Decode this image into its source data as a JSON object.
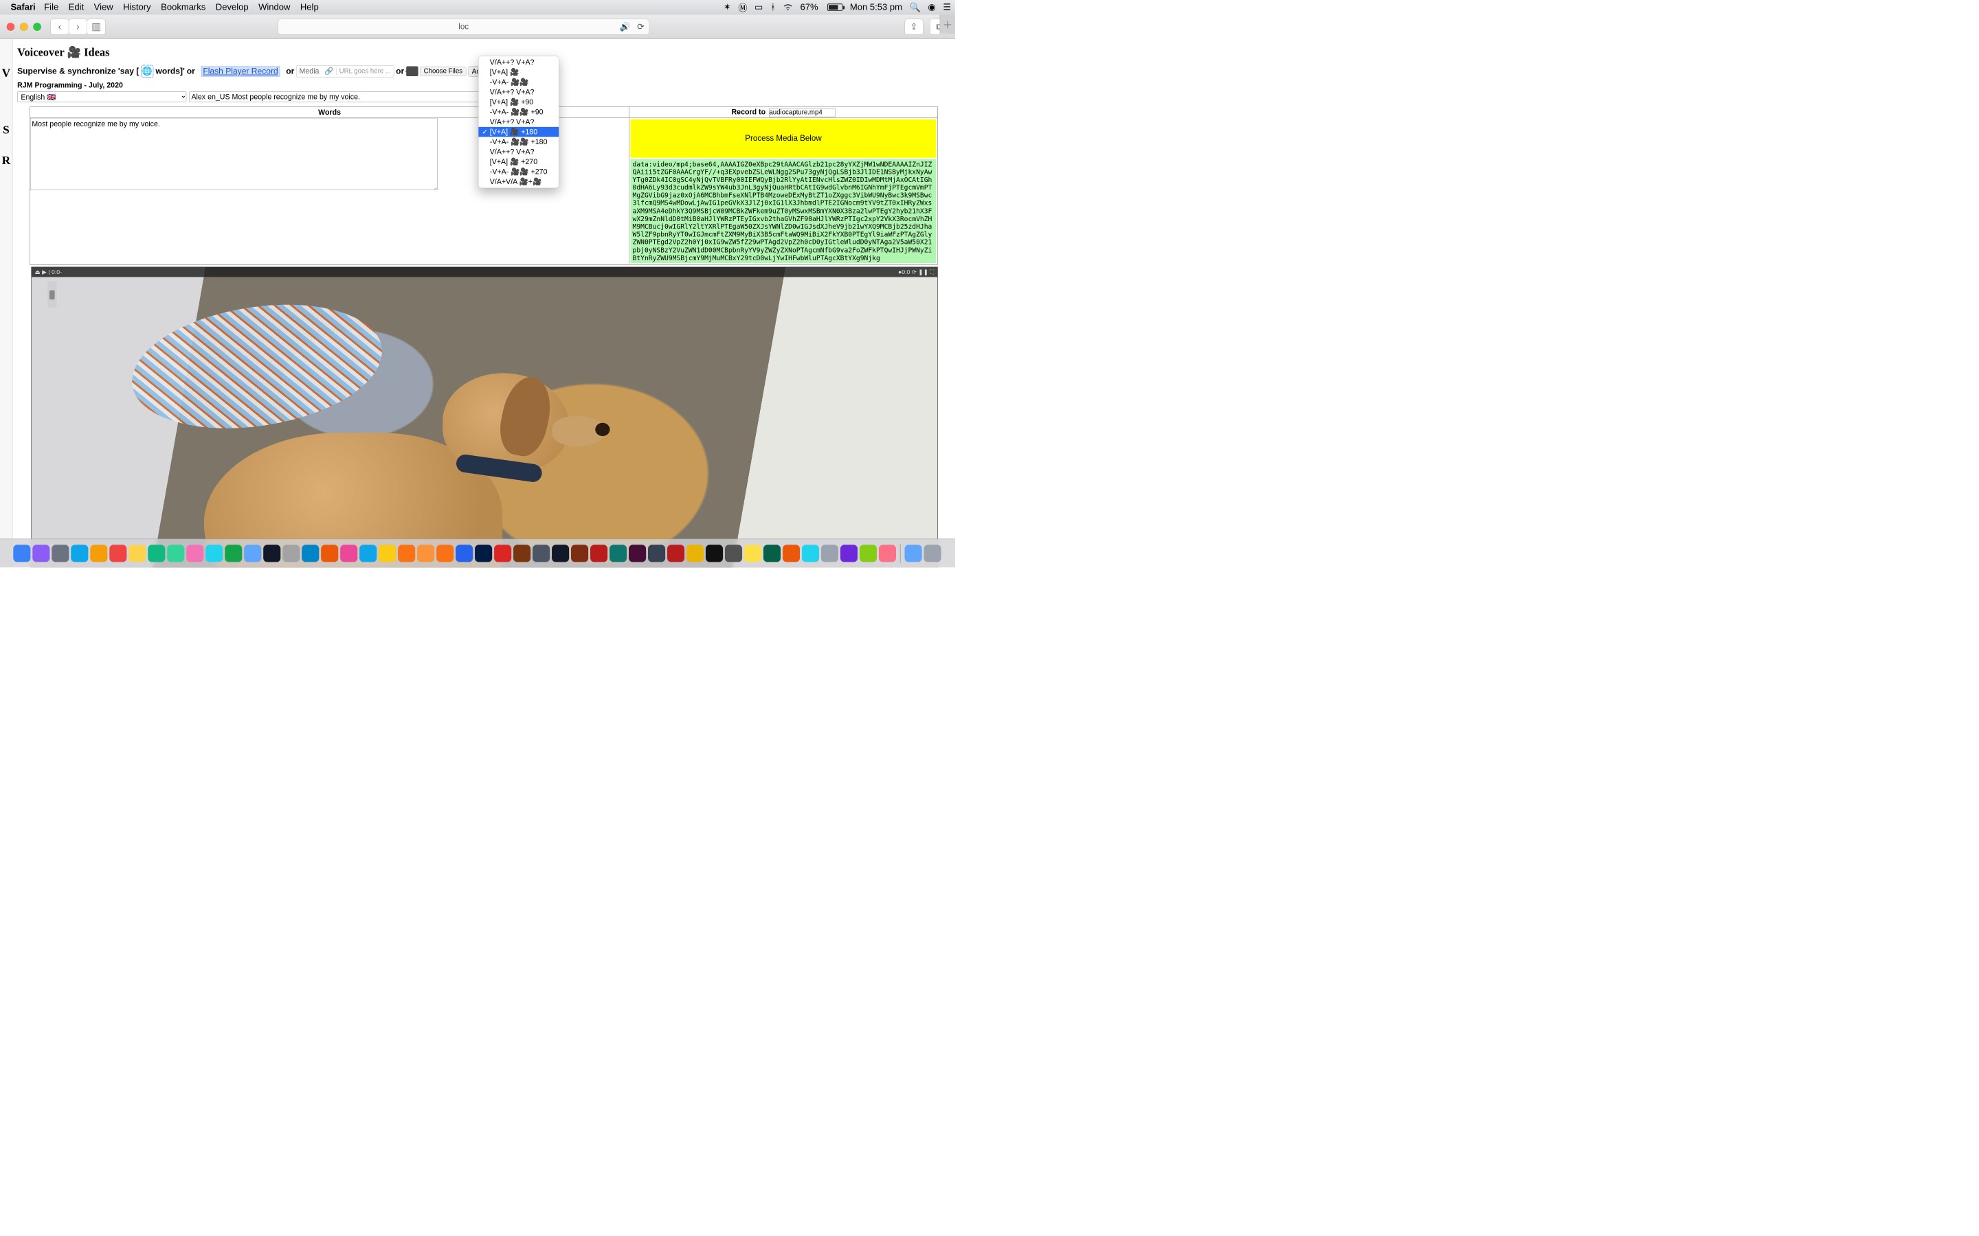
{
  "menubar": {
    "app": "Safari",
    "items": [
      "File",
      "Edit",
      "View",
      "History",
      "Bookmarks",
      "Develop",
      "Window",
      "Help"
    ],
    "battery": "67%",
    "clock": "Mon 5:53 pm"
  },
  "toolbar": {
    "url": "loc"
  },
  "page": {
    "title": "Voiceover 🎥  Ideas",
    "supervise_prefix": "Supervise & synchronize 'say [",
    "supervise_words": "words]'",
    "or1": "or",
    "flash": "Flash Player Record",
    "or2": "or",
    "media_label": "Media",
    "url_placeholder": "URL goes here ...",
    "or3": "or",
    "choose_files": "Choose Files",
    "audio_select": "Audio Separ",
    "subtitle": "RJM Programming - July, 2020",
    "lang_select": "English 🇬🇧",
    "voice_input": "Alex en_US Most people recognize me by my voice.",
    "th_words": "Words",
    "th_record": "Record to",
    "record_file": "audiocapture.mp4",
    "words_text": "Most people recognize me by my voice.",
    "process": "Process Media Below",
    "b64": "data:video/mp4;base64,AAAAIGZ0eXBpc29tAAACAGlzb21pc28yYXZjMW1wNDEAAAAIZnJIZQAiii5tZGF0AAACrgYF//+q3EXpvebZSLeWLNgg2SPu73gyNjQgLSBjb3JlIDE1NSByMjkxNyAwYTg0ZDk4IC0gSC4yNjQvTVBFRy00IEFWQyBjb2RlYyAtIENvcHlsZWZ0IDIwMDMtMjAxOCAtIGh0dHA6Ly93d3cudmlkZW9sYW4ub3JnL3gyNjQuaHRtbCAtIG9wdGlvbnM6IGNhYmFjPTEgcmVmPTMgZGVibG9jaz0xOjA6MCBhbmFseXNlPTB4MzoweDExMyBtZT1oZXggc3VibWU9NyBwc3k9MSBwc3lfcmQ9MS4wMDowLjAwIG1peGVkX3JlZj0xIG1lX3JhbmdlPTE2IGNocm9tYV9tZT0xIHRyZWxsaXM9MSA4eDhkY3Q9MSBjcW09MCBkZWFkem9uZT0yMSwxMSBmYXN0X3Bza2lwPTEgY2hyb21hX3FwX29mZnNldD0tMiB0aHJlYWRzPTEyIGxvb2thaGVhZF90aHJlYWRzPTIgc2xpY2VkX3RocmVhZHM9MCBucj0wIGRlY2ltYXRlPTEgaW50ZXJsYWNlZD0wIGJsdXJheV9jb21wYXQ9MCBjb25zdHJhaW5lZF9pbnRyYT0wIGJmcmFtZXM9MyBiX3B5cmFtaWQ9MiBiX2FkYXB0PTEgYl9iaWFzPTAgZGlyZWN0PTEgd2VpZ2h0Yj0xIG9wZW5fZ29wPTAgd2VpZ2h0cD0yIGtleWludD0yNTAga2V5aW50X21pbj0yNSBzY2VuZWN1dD00MCBpbnRyYV9yZWZyZXNoPTAgcmNfbG9va2FoZWFkPTQwIHJjPWNyZiBtYnRyZWU9MSBjcmY9MjMuMCBxY29tcD0wLjYwIHFwbWluPTAgcXBtYXg9Njkg"
  },
  "dropdown": {
    "items": [
      "V/A++? V+A?",
      "[V+A] 🎥",
      "-V+A- 🎥🎥",
      "V/A++? V+A?",
      "[V+A] 🎥 +90",
      "-V+A- 🎥🎥 +90",
      "V/A++? V+A?",
      "[V+A] 🎥 +180",
      "-V+A- 🎥🎥 +180",
      "V/A++? V+A?",
      "[V+A] 🎥 +270",
      "-V+A- 🎥🎥 +270",
      "V/A+V/A 🎥+🎥"
    ],
    "selected_index": 7
  },
  "video_bar": {
    "left": "⏏  ▶ | 0:0-",
    "right": "●0:0  ⟳  ❚❚  ⛶"
  },
  "left_letters": [
    "V",
    "S",
    "R"
  ],
  "dock_icons": [
    "finder",
    "siri",
    "launchpad",
    "safari",
    "preview",
    "calendar",
    "notes",
    "reminders",
    "maps",
    "photos",
    "messages",
    "facetime",
    "mail",
    "stocks",
    "contacts",
    "appstore",
    "a1",
    "music",
    "a2",
    "a3",
    "a4",
    "a5",
    "firefox",
    "chrome",
    "ps",
    "opera",
    "a6",
    "gimp",
    "terminal",
    "a7",
    "a8",
    "r",
    "xd",
    "a9",
    "fz",
    "a10",
    "f",
    "a11",
    "a12",
    "a13",
    "a14",
    "q",
    "a15",
    "a16",
    "a17",
    "a18",
    "folder",
    "trash"
  ]
}
